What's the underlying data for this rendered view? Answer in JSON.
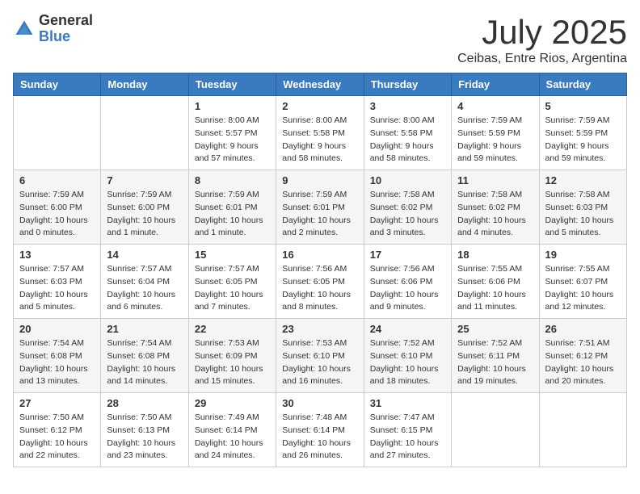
{
  "logo": {
    "general": "General",
    "blue": "Blue"
  },
  "title": "July 2025",
  "subtitle": "Ceibas, Entre Rios, Argentina",
  "days_of_week": [
    "Sunday",
    "Monday",
    "Tuesday",
    "Wednesday",
    "Thursday",
    "Friday",
    "Saturday"
  ],
  "weeks": [
    [
      {
        "day": "",
        "info": ""
      },
      {
        "day": "",
        "info": ""
      },
      {
        "day": "1",
        "info": "Sunrise: 8:00 AM\nSunset: 5:57 PM\nDaylight: 9 hours\nand 57 minutes."
      },
      {
        "day": "2",
        "info": "Sunrise: 8:00 AM\nSunset: 5:58 PM\nDaylight: 9 hours\nand 58 minutes."
      },
      {
        "day": "3",
        "info": "Sunrise: 8:00 AM\nSunset: 5:58 PM\nDaylight: 9 hours\nand 58 minutes."
      },
      {
        "day": "4",
        "info": "Sunrise: 7:59 AM\nSunset: 5:59 PM\nDaylight: 9 hours\nand 59 minutes."
      },
      {
        "day": "5",
        "info": "Sunrise: 7:59 AM\nSunset: 5:59 PM\nDaylight: 9 hours\nand 59 minutes."
      }
    ],
    [
      {
        "day": "6",
        "info": "Sunrise: 7:59 AM\nSunset: 6:00 PM\nDaylight: 10 hours\nand 0 minutes."
      },
      {
        "day": "7",
        "info": "Sunrise: 7:59 AM\nSunset: 6:00 PM\nDaylight: 10 hours\nand 1 minute."
      },
      {
        "day": "8",
        "info": "Sunrise: 7:59 AM\nSunset: 6:01 PM\nDaylight: 10 hours\nand 1 minute."
      },
      {
        "day": "9",
        "info": "Sunrise: 7:59 AM\nSunset: 6:01 PM\nDaylight: 10 hours\nand 2 minutes."
      },
      {
        "day": "10",
        "info": "Sunrise: 7:58 AM\nSunset: 6:02 PM\nDaylight: 10 hours\nand 3 minutes."
      },
      {
        "day": "11",
        "info": "Sunrise: 7:58 AM\nSunset: 6:02 PM\nDaylight: 10 hours\nand 4 minutes."
      },
      {
        "day": "12",
        "info": "Sunrise: 7:58 AM\nSunset: 6:03 PM\nDaylight: 10 hours\nand 5 minutes."
      }
    ],
    [
      {
        "day": "13",
        "info": "Sunrise: 7:57 AM\nSunset: 6:03 PM\nDaylight: 10 hours\nand 5 minutes."
      },
      {
        "day": "14",
        "info": "Sunrise: 7:57 AM\nSunset: 6:04 PM\nDaylight: 10 hours\nand 6 minutes."
      },
      {
        "day": "15",
        "info": "Sunrise: 7:57 AM\nSunset: 6:05 PM\nDaylight: 10 hours\nand 7 minutes."
      },
      {
        "day": "16",
        "info": "Sunrise: 7:56 AM\nSunset: 6:05 PM\nDaylight: 10 hours\nand 8 minutes."
      },
      {
        "day": "17",
        "info": "Sunrise: 7:56 AM\nSunset: 6:06 PM\nDaylight: 10 hours\nand 9 minutes."
      },
      {
        "day": "18",
        "info": "Sunrise: 7:55 AM\nSunset: 6:06 PM\nDaylight: 10 hours\nand 11 minutes."
      },
      {
        "day": "19",
        "info": "Sunrise: 7:55 AM\nSunset: 6:07 PM\nDaylight: 10 hours\nand 12 minutes."
      }
    ],
    [
      {
        "day": "20",
        "info": "Sunrise: 7:54 AM\nSunset: 6:08 PM\nDaylight: 10 hours\nand 13 minutes."
      },
      {
        "day": "21",
        "info": "Sunrise: 7:54 AM\nSunset: 6:08 PM\nDaylight: 10 hours\nand 14 minutes."
      },
      {
        "day": "22",
        "info": "Sunrise: 7:53 AM\nSunset: 6:09 PM\nDaylight: 10 hours\nand 15 minutes."
      },
      {
        "day": "23",
        "info": "Sunrise: 7:53 AM\nSunset: 6:10 PM\nDaylight: 10 hours\nand 16 minutes."
      },
      {
        "day": "24",
        "info": "Sunrise: 7:52 AM\nSunset: 6:10 PM\nDaylight: 10 hours\nand 18 minutes."
      },
      {
        "day": "25",
        "info": "Sunrise: 7:52 AM\nSunset: 6:11 PM\nDaylight: 10 hours\nand 19 minutes."
      },
      {
        "day": "26",
        "info": "Sunrise: 7:51 AM\nSunset: 6:12 PM\nDaylight: 10 hours\nand 20 minutes."
      }
    ],
    [
      {
        "day": "27",
        "info": "Sunrise: 7:50 AM\nSunset: 6:12 PM\nDaylight: 10 hours\nand 22 minutes."
      },
      {
        "day": "28",
        "info": "Sunrise: 7:50 AM\nSunset: 6:13 PM\nDaylight: 10 hours\nand 23 minutes."
      },
      {
        "day": "29",
        "info": "Sunrise: 7:49 AM\nSunset: 6:14 PM\nDaylight: 10 hours\nand 24 minutes."
      },
      {
        "day": "30",
        "info": "Sunrise: 7:48 AM\nSunset: 6:14 PM\nDaylight: 10 hours\nand 26 minutes."
      },
      {
        "day": "31",
        "info": "Sunrise: 7:47 AM\nSunset: 6:15 PM\nDaylight: 10 hours\nand 27 minutes."
      },
      {
        "day": "",
        "info": ""
      },
      {
        "day": "",
        "info": ""
      }
    ]
  ]
}
